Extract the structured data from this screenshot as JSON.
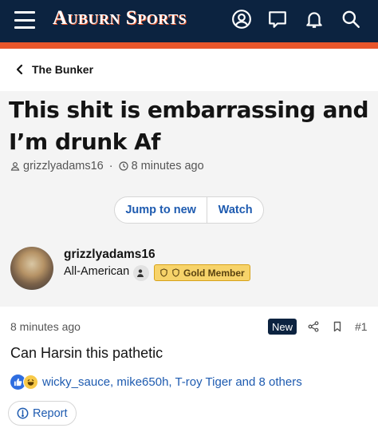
{
  "header": {
    "brand": "Auburn Sports",
    "menu_icon": "hamburger-icon",
    "icons": [
      "account-icon",
      "message-icon",
      "bell-icon",
      "search-icon"
    ],
    "colors": {
      "navbar": "#0c2340",
      "accent": "#e8562b"
    }
  },
  "breadcrumb": {
    "label": "The Bunker",
    "icon": "chevron-left-icon"
  },
  "thread": {
    "title": "This shit is embarrassing and I’m drunk Af",
    "author": "grizzlyadams16",
    "separator": "·",
    "time": "8 minutes ago",
    "jump_label": "Jump to new",
    "watch_label": "Watch"
  },
  "author_card": {
    "name": "grizzlyadams16",
    "rank": "All-American",
    "badge": "Gold Member",
    "colors": {
      "badge_bg": "#f7d36a",
      "badge_border": "#d7a21a"
    }
  },
  "post": {
    "time": "8 minutes ago",
    "new_badge": "New",
    "number": "#1",
    "text": "Can Harsin this pathetic",
    "reactions_text": "wicky_sauce, mike650h, T-roy Tiger and 8 others",
    "reaction_icons": [
      "like-icon",
      "laugh-icon"
    ],
    "report_label": "Report",
    "colors": {
      "link": "#1e5bb0"
    }
  }
}
